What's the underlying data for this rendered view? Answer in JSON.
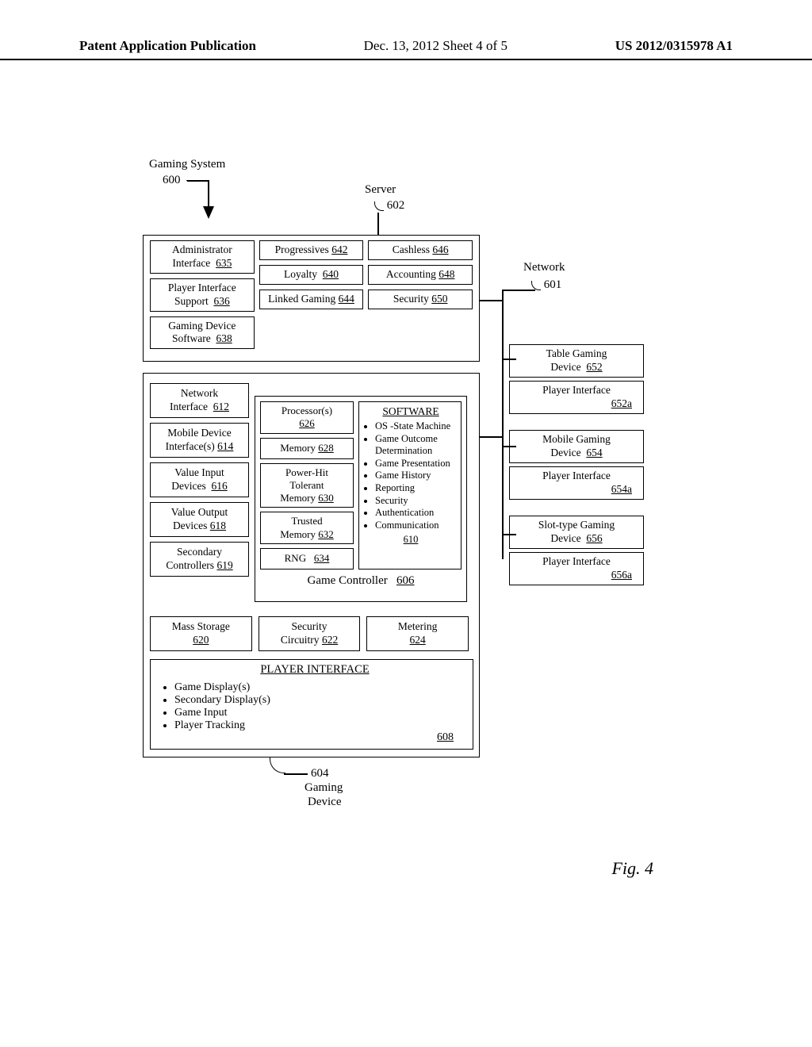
{
  "header": {
    "left": "Patent Application Publication",
    "mid": "Dec. 13, 2012  Sheet 4 of 5",
    "right": "US 2012/0315978 A1"
  },
  "diagram": {
    "system_label": "Gaming System",
    "system_ref": "600",
    "server_label": "Server",
    "server_ref": "602",
    "network_label": "Network",
    "network_ref": "601",
    "gaming_device_label_1": "Gaming",
    "gaming_device_label_2": "Device",
    "gaming_device_ref": "604",
    "fig": "Fig. 4",
    "server": {
      "c1r1": {
        "t1": "Administrator",
        "t2": "Interface",
        "r": "635"
      },
      "c1r2": {
        "t1": "Player Interface",
        "t2": "Support",
        "r": "636"
      },
      "c1r3": {
        "t1": "Gaming Device",
        "t2": "Software",
        "r": "638"
      },
      "c2r1": {
        "t1": "Progressives",
        "r": "642"
      },
      "c2r2": {
        "t1": "Loyalty",
        "r": "640"
      },
      "c2r3": {
        "t1": "Linked Gaming",
        "r": "644"
      },
      "c3r1": {
        "t1": "Cashless",
        "r": "646"
      },
      "c3r2": {
        "t1": "Accounting",
        "r": "648"
      },
      "c3r3": {
        "t1": "Security",
        "r": "650"
      }
    },
    "device": {
      "l1": {
        "t1": "Network",
        "t2": "Interface",
        "r": "612"
      },
      "l2": {
        "t1": "Mobile Device",
        "t2": "Interface(s)",
        "r": "614"
      },
      "l3": {
        "t1": "Value Input",
        "t2": "Devices",
        "r": "616"
      },
      "l4": {
        "t1": "Value Output",
        "t2": "Devices",
        "r": "618"
      },
      "l5": {
        "t1": "Secondary",
        "t2": "Controllers",
        "r": "619"
      },
      "l6": {
        "t1": "Mass Storage",
        "r": "620"
      },
      "r2": {
        "t1": "Security",
        "t2": "Circuitry",
        "r": "622"
      },
      "r3": {
        "t1": "Metering",
        "r": "624"
      },
      "gc": {
        "title": "Game Controller",
        "title_ref": "606",
        "p1": {
          "t1": "Processor(s)",
          "r": "626"
        },
        "p2": {
          "t1": "Memory",
          "r": "628"
        },
        "p3": {
          "t1": "Power-Hit",
          "t2": "Tolerant",
          "t3": "Memory",
          "r": "630"
        },
        "p4": {
          "t1": "Trusted",
          "t2": "Memory",
          "r": "632"
        },
        "p5": {
          "t1": "RNG",
          "r": "634"
        },
        "sw": {
          "title": "SOFTWARE",
          "i1": "OS -State Machine",
          "i2": "Game Outcome Determination",
          "i3": "Game Presentation",
          "i4": "Game History",
          "i5": "Reporting",
          "i6": "Security",
          "i7": "Authentication",
          "i8": "Communication",
          "ref": "610"
        }
      },
      "pi": {
        "title": "PLAYER INTERFACE",
        "i1": "Game Display(s)",
        "i2": "Secondary Display(s)",
        "i3": "Game Input",
        "i4": "Player Tracking",
        "ref": "608"
      }
    },
    "net": {
      "d1": {
        "t1": "Table Gaming",
        "t2": "Device",
        "r": "652"
      },
      "d1i": {
        "t1": "Player Interface",
        "r": "652a"
      },
      "d2": {
        "t1": "Mobile Gaming",
        "t2": "Device",
        "r": "654"
      },
      "d2i": {
        "t1": "Player Interface",
        "r": "654a"
      },
      "d3": {
        "t1": "Slot-type Gaming",
        "t2": "Device",
        "r": "656"
      },
      "d3i": {
        "t1": "Player Interface",
        "r": "656a"
      }
    }
  }
}
